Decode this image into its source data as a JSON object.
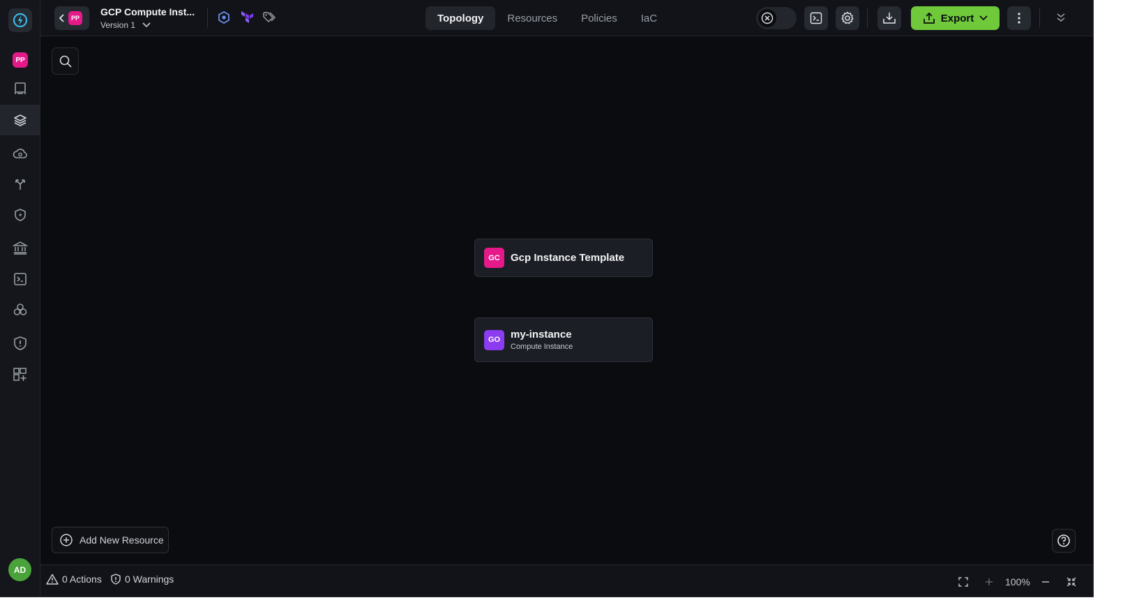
{
  "project": {
    "workspace_initials": "PP",
    "title": "GCP Compute Inst...",
    "version": "Version 1"
  },
  "tabs": [
    "Topology",
    "Resources",
    "Policies",
    "IaC"
  ],
  "active_tab": "Topology",
  "toolbar": {
    "export_label": "Export"
  },
  "sidebar": {
    "workspace_initials": "PP",
    "items": [
      "catalog-icon",
      "layers-icon",
      "cloud-icon",
      "git-branch-icon",
      "shield-bolt-icon",
      "bank-icon",
      "terminal-icon",
      "cubes-icon",
      "shield-alert-icon",
      "grid-plus-icon"
    ],
    "user_initials": "AD"
  },
  "canvas": {
    "nodes": [
      {
        "badge": "GC",
        "name": "Gcp Instance Template",
        "badge_color": "#e5198a"
      },
      {
        "badge": "GO",
        "name": "my-instance",
        "type": "Compute Instance",
        "badge_color": "#8b3cf0"
      }
    ],
    "add_resource_label": "Add New Resource"
  },
  "footer": {
    "actions": "0 Actions",
    "warnings": "0 Warnings",
    "zoom": "100%"
  },
  "colors": {
    "accent_green": "#6fc93a",
    "workspace_pink": "#e5198a",
    "background": "#0b0c10"
  }
}
